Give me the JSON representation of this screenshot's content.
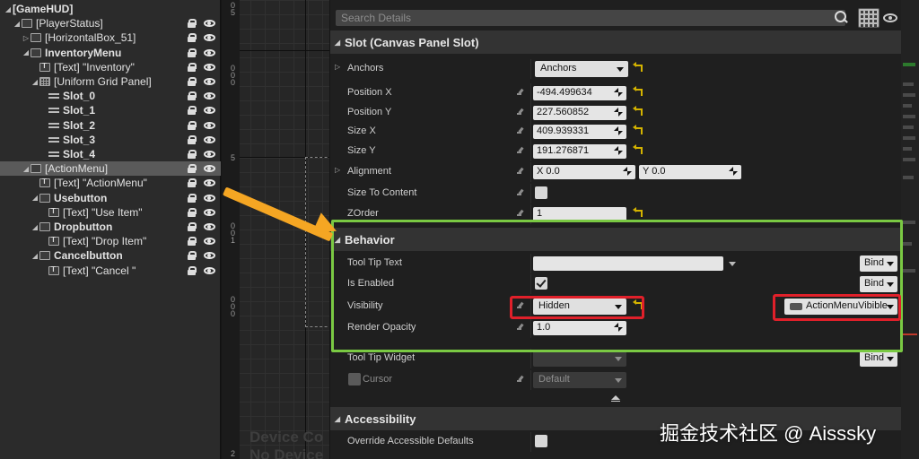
{
  "hierarchy": {
    "items": [
      {
        "label": "[GameHUD]",
        "icon": "none",
        "bold": true,
        "arrow": "down",
        "depth": 0
      },
      {
        "label": "[PlayerStatus]",
        "icon": "canvas",
        "bold": false,
        "arrow": "down",
        "depth": 1
      },
      {
        "label": "[HorizontalBox_51]",
        "icon": "hbox",
        "bold": false,
        "arrow": "right",
        "depth": 2
      },
      {
        "label": "InventoryMenu",
        "icon": "canvas",
        "bold": true,
        "arrow": "down",
        "depth": 2
      },
      {
        "label": "[Text] \"Inventory\"",
        "icon": "text",
        "bold": false,
        "arrow": "",
        "depth": 3
      },
      {
        "label": "[Uniform Grid Panel]",
        "icon": "grid",
        "bold": false,
        "arrow": "down",
        "depth": 3
      },
      {
        "label": "Slot_0",
        "icon": "slot",
        "bold": true,
        "arrow": "",
        "depth": 4
      },
      {
        "label": "Slot_1",
        "icon": "slot",
        "bold": true,
        "arrow": "",
        "depth": 4
      },
      {
        "label": "Slot_2",
        "icon": "slot",
        "bold": true,
        "arrow": "",
        "depth": 4
      },
      {
        "label": "Slot_3",
        "icon": "slot",
        "bold": true,
        "arrow": "",
        "depth": 4
      },
      {
        "label": "Slot_4",
        "icon": "slot",
        "bold": true,
        "arrow": "",
        "depth": 4
      },
      {
        "label": "[ActionMenu]",
        "icon": "canvas",
        "bold": false,
        "arrow": "down",
        "depth": 2,
        "selected": true
      },
      {
        "label": "[Text] \"ActionMenu\"",
        "icon": "text",
        "bold": false,
        "arrow": "",
        "depth": 3
      },
      {
        "label": "Usebutton",
        "icon": "button",
        "bold": true,
        "arrow": "down",
        "depth": 3
      },
      {
        "label": "[Text] \"Use Item\"",
        "icon": "text",
        "bold": false,
        "arrow": "",
        "depth": 4
      },
      {
        "label": "Dropbutton",
        "icon": "button",
        "bold": true,
        "arrow": "down",
        "depth": 3
      },
      {
        "label": "[Text] \"Drop Item\"",
        "icon": "text",
        "bold": false,
        "arrow": "",
        "depth": 4
      },
      {
        "label": "Cancelbutton",
        "icon": "button",
        "bold": true,
        "arrow": "down",
        "depth": 3
      },
      {
        "label": "[Text] \"Cancel \"",
        "icon": "text",
        "bold": false,
        "arrow": "",
        "depth": 4
      }
    ]
  },
  "viewport": {
    "ruler_labels": [
      "0",
      "5",
      "0",
      "0",
      "0",
      "5",
      "0",
      "0",
      "1",
      "0",
      "0",
      "0",
      "2"
    ],
    "overlay_text_1": "Device Co",
    "overlay_text_2": "No Device"
  },
  "details": {
    "search_placeholder": "Search Details",
    "slot_section": "Slot (Canvas Panel Slot)",
    "anchors_label": "Anchors",
    "anchors_value": "Anchors",
    "position_x_label": "Position X",
    "position_x_value": "-494.499634",
    "position_y_label": "Position Y",
    "position_y_value": "227.560852",
    "size_x_label": "Size X",
    "size_x_value": "409.939331",
    "size_y_label": "Size Y",
    "size_y_value": "191.276871",
    "alignment_label": "Alignment",
    "alignment_x": "X  0.0",
    "alignment_y": "Y  0.0",
    "size_to_content_label": "Size To Content",
    "zorder_label": "ZOrder",
    "zorder_value": "1",
    "behavior_section": "Behavior",
    "tooltip_text_label": "Tool Tip Text",
    "tooltip_text_value": "",
    "is_enabled_label": "Is Enabled",
    "visibility_label": "Visibility",
    "visibility_value": "Hidden",
    "render_opacity_label": "Render Opacity",
    "render_opacity_value": "1.0",
    "tooltip_widget_label": "Tool Tip Widget",
    "cursor_label": "Cursor",
    "cursor_value": "Default",
    "bind_label": "Bind",
    "visibility_binding": "ActionMenuVibible",
    "accessibility_section": "Accessibility",
    "override_accessible_label": "Override Accessible Defaults"
  },
  "watermark": "掘金技术社区 @ Aisssky",
  "colors": {
    "highlight_green": "#7ac943",
    "highlight_red": "#e0202a",
    "arrow_orange": "#f5a623",
    "reset_yellow": "#d4b300"
  }
}
